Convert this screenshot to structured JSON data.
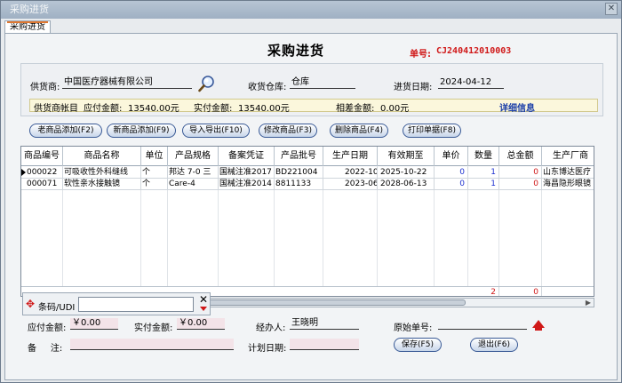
{
  "window": {
    "title": "采购进货",
    "close_glyph": "✕"
  },
  "tab": {
    "label": "采购进货"
  },
  "header": {
    "title": "采购进货",
    "order_no_label": "单号:",
    "order_no": "CJ240412010003",
    "supplier_label": "供货商:",
    "supplier": "中国医疗器械有限公司",
    "warehouse_label": "收货仓库:",
    "warehouse": "仓库",
    "date_label": "进货日期:",
    "date": "2024-04-12"
  },
  "account": {
    "label": "供货商帐目",
    "payable_label": "应付金额:",
    "payable": "13540.00元",
    "paid_label": "实付金额:",
    "paid": "13540.00元",
    "diff_label": "相差金额:",
    "diff": "0.00元",
    "detail_link": "详细信息"
  },
  "toolbar": [
    {
      "label": "老商品添加(F2)"
    },
    {
      "label": "新商品添加(F9)"
    },
    {
      "label": "导入导出(F10)"
    },
    {
      "label": "修改商品(F3)"
    },
    {
      "label": "删除商品(F4)"
    },
    {
      "label": "打印单据(F8)"
    }
  ],
  "table": {
    "columns": [
      "商品编号",
      "商品名称",
      "单位",
      "产品规格",
      "备案凭证",
      "产品批号",
      "生产日期",
      "有效期至",
      "单价",
      "数量",
      "总金额",
      "生产厂商"
    ],
    "rows": [
      [
        "000022",
        "可吸收性外科缝线",
        "个",
        "邦达 7-0 三",
        "国械注准2017",
        "BD221004",
        "2022-10-16",
        "2025-10-22",
        "0",
        "1",
        "0",
        "山东博达医疗"
      ],
      [
        "000071",
        "软性亲水接触镜",
        "个",
        "Care-4",
        "国械注准2014",
        "8811133",
        "2023-06-14",
        "2028-06-13",
        "0",
        "1",
        "0",
        "海昌隐形眼镜"
      ]
    ],
    "totals": {
      "qty": "2",
      "amount": "0"
    }
  },
  "barcode": {
    "label": "条码/UDI",
    "value": ""
  },
  "footer": {
    "payable_label": "应付金额:",
    "payable": "￥0.00",
    "paid_label": "实付金额:",
    "paid": "￥0.00",
    "handler_label": "经办人:",
    "handler": "王晓明",
    "orig_no_label": "原始单号:",
    "orig_no": "",
    "remark_label": "备     注:",
    "remark": "",
    "plan_date_label": "计划日期:",
    "plan_date": ""
  },
  "buttons": {
    "save": "保存(F5)",
    "exit": "退出(F6)"
  }
}
